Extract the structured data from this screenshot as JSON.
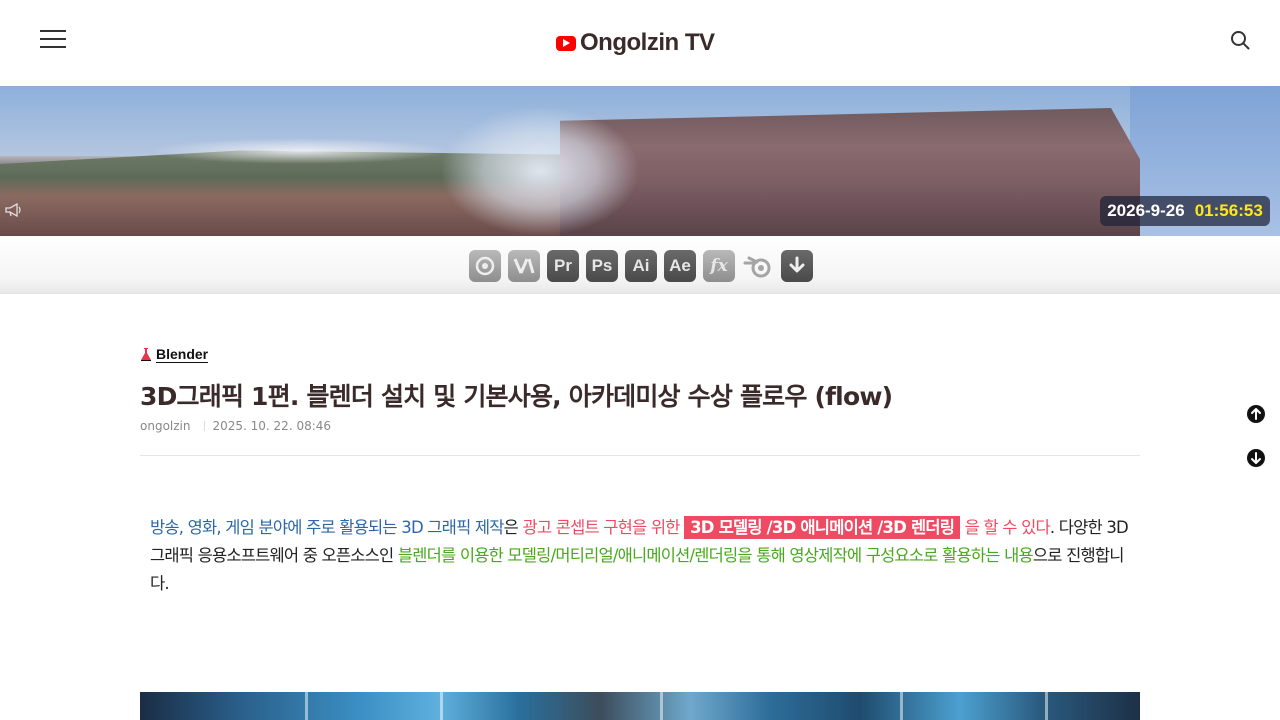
{
  "header": {
    "logo_text": "Ongolzin TV",
    "menu_icon": "hamburger-menu-icon",
    "search_icon": "search-icon",
    "accent_color": "#ff0000"
  },
  "banner": {
    "date": "2026-9-26",
    "time": "01:56:53",
    "time_color": "#ffe81a",
    "megaphone_icon": "megaphone-icon"
  },
  "toolbar": {
    "tools": [
      {
        "label": "",
        "icon": "davinci-resolve-icon"
      },
      {
        "label": "",
        "icon": "vegas-icon"
      },
      {
        "label": "Pr",
        "icon": "premiere-icon"
      },
      {
        "label": "Ps",
        "icon": "photoshop-icon"
      },
      {
        "label": "Ai",
        "icon": "illustrator-icon"
      },
      {
        "label": "Ae",
        "icon": "after-effects-icon"
      },
      {
        "label": "fx",
        "icon": "effects-icon"
      },
      {
        "label": "",
        "icon": "blender-icon"
      },
      {
        "label": "",
        "icon": "download-icon"
      }
    ]
  },
  "post": {
    "category": "Blender",
    "title": "3D그래픽 1편. 블렌더 설치 및 기본사용, 아카데미상 수상 플로우 (flow)",
    "author": "ongolzin",
    "date": "2025. 10. 22. 08:46",
    "paragraph": {
      "part1": "방송, 영화, 게임 분야에 주로 활용되는 3D 그래픽 제작",
      "part2": "은 ",
      "part3": "광고 콘셉트 구현을 위한",
      "highlight": "3D 모델링 /3D 애니메이션 /3D 렌더링",
      "part4": " 을 할 수 있다",
      "part5": ". 다양한 3D그래픽 응용소프트웨어 중 오픈소스인 ",
      "part6": "블렌더를 이용한 모델링/머티리얼/애니메이션/렌더링을 통해 영상제작에 구성요소로 활용하는 내용",
      "part7": "으로 진행합니다."
    }
  },
  "side": {
    "up_icon": "scroll-up-icon",
    "down_icon": "scroll-down-icon"
  }
}
